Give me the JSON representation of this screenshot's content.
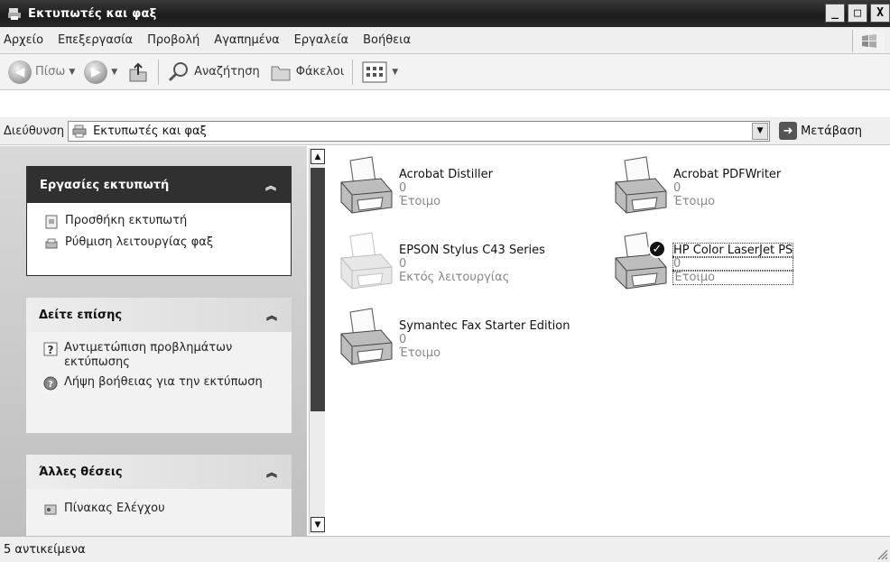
{
  "window": {
    "title": "Εκτυπωτές και φαξ",
    "buttons": [
      "_",
      "□",
      "X"
    ]
  },
  "menu": [
    "Αρχείο",
    "Επεξεργασία",
    "Προβολή",
    "Αγαπημένα",
    "Εργαλεία",
    "Βοήθεια"
  ],
  "toolbar": {
    "back": "Πίσω",
    "search": "Αναζήτηση",
    "folders": "Φάκελοι"
  },
  "address": {
    "label": "Διεύθυνση",
    "value": "Εκτυπωτές και φαξ",
    "go": "Μετάβαση"
  },
  "panels": {
    "tasks": {
      "title": "Εργασίες εκτυπωτή",
      "items": [
        "Προσθήκη εκτυπωτή",
        "Ρύθμιση λειτουργίας φαξ"
      ]
    },
    "see_also": {
      "title": "Δείτε επίσης",
      "items": [
        "Αντιμετώπιση προβλημάτων εκτύπωσης",
        "Λήψη βοήθειας για την εκτύπωση"
      ]
    },
    "other": {
      "title": "Άλλες θέσεις",
      "items": [
        "Πίνακας Ελέγχου"
      ]
    }
  },
  "printers": [
    {
      "name": "Acrobat Distiller",
      "docs": "0",
      "status": "Έτοιμο",
      "default": false,
      "offline": false
    },
    {
      "name": "Acrobat PDFWriter",
      "docs": "0",
      "status": "Έτοιμο",
      "default": false,
      "offline": false
    },
    {
      "name": "EPSON Stylus C43 Series",
      "docs": "0",
      "status": "Εκτός λειτουργίας",
      "default": false,
      "offline": true
    },
    {
      "name": "HP Color LaserJet PS",
      "docs": "0",
      "status": "Έτοιμο",
      "default": true,
      "offline": false,
      "selected": true
    },
    {
      "name": "Symantec Fax Starter Edition",
      "docs": "0",
      "status": "Έτοιμο",
      "default": false,
      "offline": false
    }
  ],
  "status": {
    "text": "5 αντικείμενα"
  }
}
